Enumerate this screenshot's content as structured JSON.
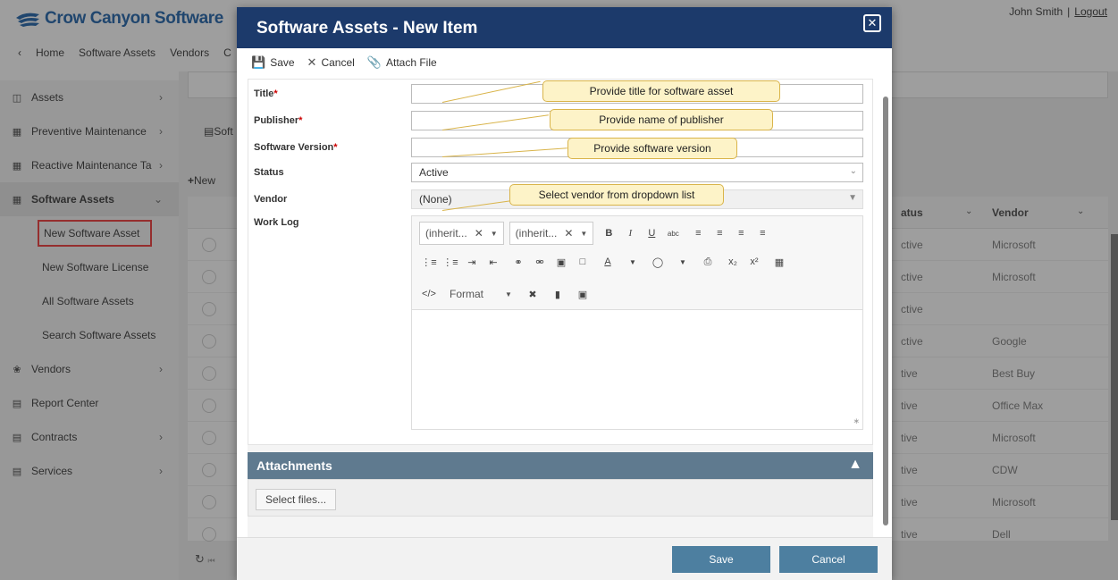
{
  "app": {
    "logo": "Crow Canyon Software",
    "user_name": "John Smith",
    "logout": "Logout",
    "topnav": [
      "Home",
      "Software Assets",
      "Vendors",
      "C"
    ]
  },
  "sidebar": {
    "items": [
      {
        "label": "Assets",
        "icon": "building-icon"
      },
      {
        "label": "Preventive Maintenance",
        "icon": "briefcase-icon"
      },
      {
        "label": "Reactive Maintenance Ta",
        "icon": "briefcase-icon"
      },
      {
        "label": "Software Assets",
        "icon": "windows-icon"
      }
    ],
    "sub_items": [
      "New Software Asset",
      "New Software License",
      "All Software Assets",
      "Search Software Assets"
    ],
    "lower_items": [
      {
        "label": "Vendors",
        "icon": "network-icon"
      },
      {
        "label": "Report Center",
        "icon": "chart-icon"
      },
      {
        "label": "Contracts",
        "icon": "document-icon"
      },
      {
        "label": "Services",
        "icon": "services-icon"
      }
    ]
  },
  "background": {
    "tab": "Soft",
    "new_button": "New",
    "columns": {
      "status": "atus",
      "vendor": "Vendor"
    },
    "rows": [
      {
        "status": "ctive",
        "vendor": "Microsoft"
      },
      {
        "status": "ctive",
        "vendor": "Microsoft"
      },
      {
        "status": "ctive",
        "vendor": ""
      },
      {
        "status": "ctive",
        "vendor": "Google"
      },
      {
        "status": "tive",
        "vendor": "Best Buy"
      },
      {
        "status": "tive",
        "vendor": "Office Max"
      },
      {
        "status": "tive",
        "vendor": "Microsoft"
      },
      {
        "status": "tive",
        "vendor": "CDW"
      },
      {
        "status": "tive",
        "vendor": "Microsoft"
      },
      {
        "status": "tive",
        "vendor": "Dell"
      }
    ]
  },
  "modal": {
    "title": "Software Assets - New Item",
    "toolbar": {
      "save": "Save",
      "cancel": "Cancel",
      "attach": "Attach File"
    },
    "fields": {
      "title_label": "Title",
      "publisher_label": "Publisher",
      "version_label": "Software Version",
      "status_label": "Status",
      "status_value": "Active",
      "vendor_label": "Vendor",
      "vendor_value": "(None)",
      "worklog_label": "Work Log",
      "required_mark": "*"
    },
    "callouts": {
      "title": "Provide title for software asset",
      "publisher": "Provide name of publisher",
      "version": "Provide software version",
      "vendor": "Select vendor from dropdown list"
    },
    "editor": {
      "font_name": "(inherit...",
      "font_size": "(inherit...",
      "format": "Format"
    },
    "attachments": {
      "title": "Attachments",
      "select_files": "Select files..."
    },
    "footer": {
      "save": "Save",
      "cancel": "Cancel"
    }
  }
}
